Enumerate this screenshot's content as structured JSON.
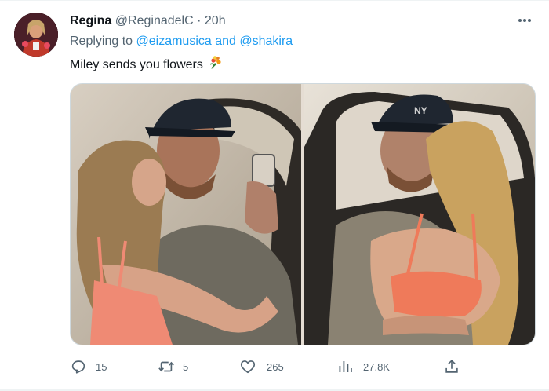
{
  "tweet": {
    "author": {
      "name": "Regina",
      "handle": "@ReginadelC",
      "separator": "·",
      "time": "20h"
    },
    "reply": {
      "prefix": "Replying to ",
      "mention_1": "@eizamusica",
      "conjunction": " and ",
      "mention_2": "@shakira"
    },
    "text": "Miley sends you flowers",
    "emoji": "bouquet-icon",
    "media": [
      {
        "name": "photo-left"
      },
      {
        "name": "photo-right"
      }
    ],
    "actions": {
      "replies": "15",
      "retweets": "5",
      "likes": "265",
      "views": "27.8K"
    }
  },
  "colors": {
    "accent": "#1d9bf0",
    "secondary_text": "#536471",
    "primary_text": "#0f1419"
  }
}
